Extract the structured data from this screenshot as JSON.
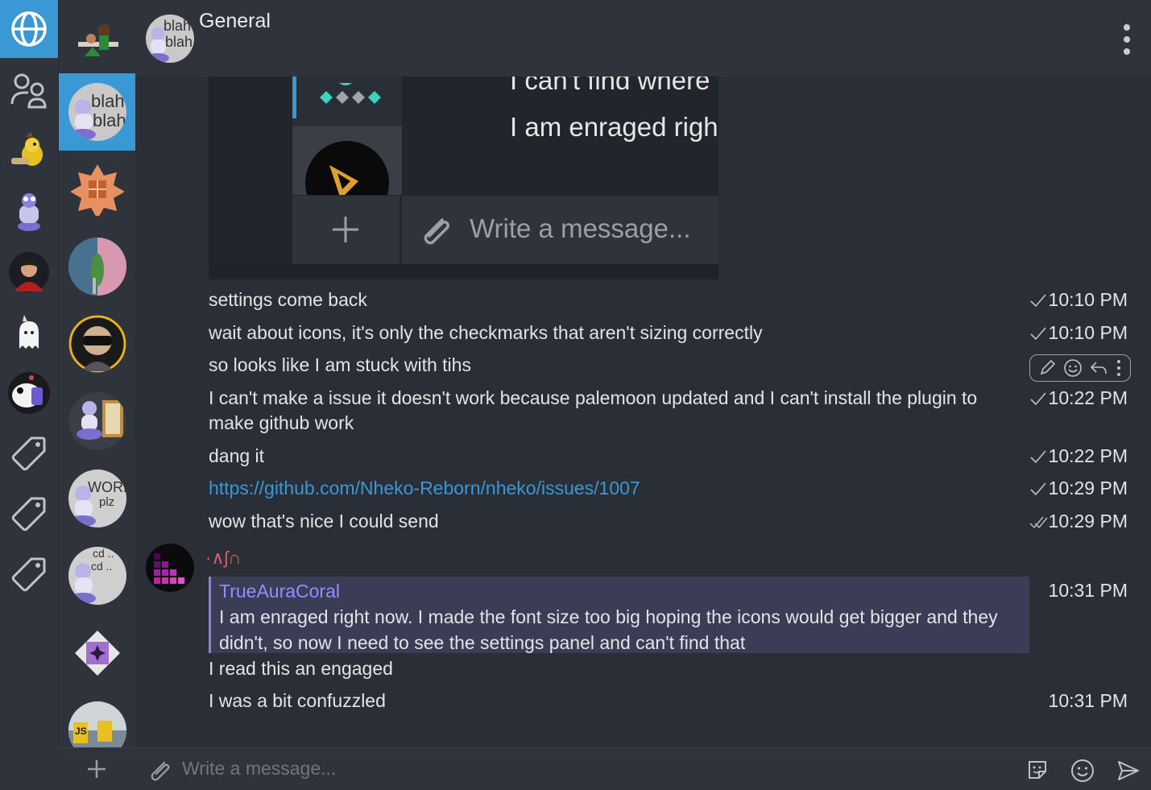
{
  "room": {
    "title": "General"
  },
  "community_bar": {
    "items": [
      "globe-icon",
      "people-icon",
      "community-bird",
      "community-robot",
      "community-portrait",
      "community-ghost",
      "community-panda",
      "tag-icon",
      "tag-icon",
      "tag-icon"
    ]
  },
  "avatar_texts": {
    "blah_top": "blah",
    "blah_bottom": "blah",
    "work": "WORK",
    "plz": "plz",
    "cd1": "cd ..",
    "cd2": "cd ..",
    "js": "JS"
  },
  "embedded_screenshot": {
    "text_line1": "I can't find where",
    "text_line2": "I am enraged righ",
    "composer_placeholder": "Write a message..."
  },
  "messages": [
    {
      "text": "settings come back",
      "time": "10:10 PM",
      "status": "sent"
    },
    {
      "text": "wait about icons, it's only the checkmarks that aren't sizing correctly",
      "time": "10:10 PM",
      "status": "sent"
    },
    {
      "text": "so looks like I am stuck with tihs",
      "time": "",
      "status": ""
    },
    {
      "text": "I can't make a issue it doesn't work because palemoon updated and I can't install the plugin to make github work",
      "time": "10:22 PM",
      "status": "sent"
    },
    {
      "text": "dang it",
      "time": "10:22 PM",
      "status": "sent"
    },
    {
      "text": "https://github.com/Nheko-Reborn/nheko/issues/1007",
      "time": "10:29 PM",
      "status": "sent"
    },
    {
      "text": "wow that's nice I could send",
      "time": "10:29 PM",
      "status": "read"
    }
  ],
  "reply_group": {
    "sender": "·∧ʃ∩",
    "reply_to_name": "TrueAuraCoral",
    "reply_to_body": "I am enraged right now. I made the font size too big hoping the icons would get bigger and they didn't, so now I need to see the settings panel and can't find that",
    "reply_time": "10:31 PM",
    "message1": "I read this an engaged",
    "message2": "I was a bit confuzzled",
    "message2_time": "10:31 PM"
  },
  "hover_actions": [
    "edit-icon",
    "emoji-icon",
    "reply-icon",
    "more-icon"
  ],
  "composer": {
    "placeholder": "Write a message..."
  },
  "colors": {
    "accent": "#3a98d5",
    "background": "#2a2e36",
    "sidebar": "#2f333b",
    "sender": "#e05e6a",
    "reply_name": "#8f8fff"
  }
}
